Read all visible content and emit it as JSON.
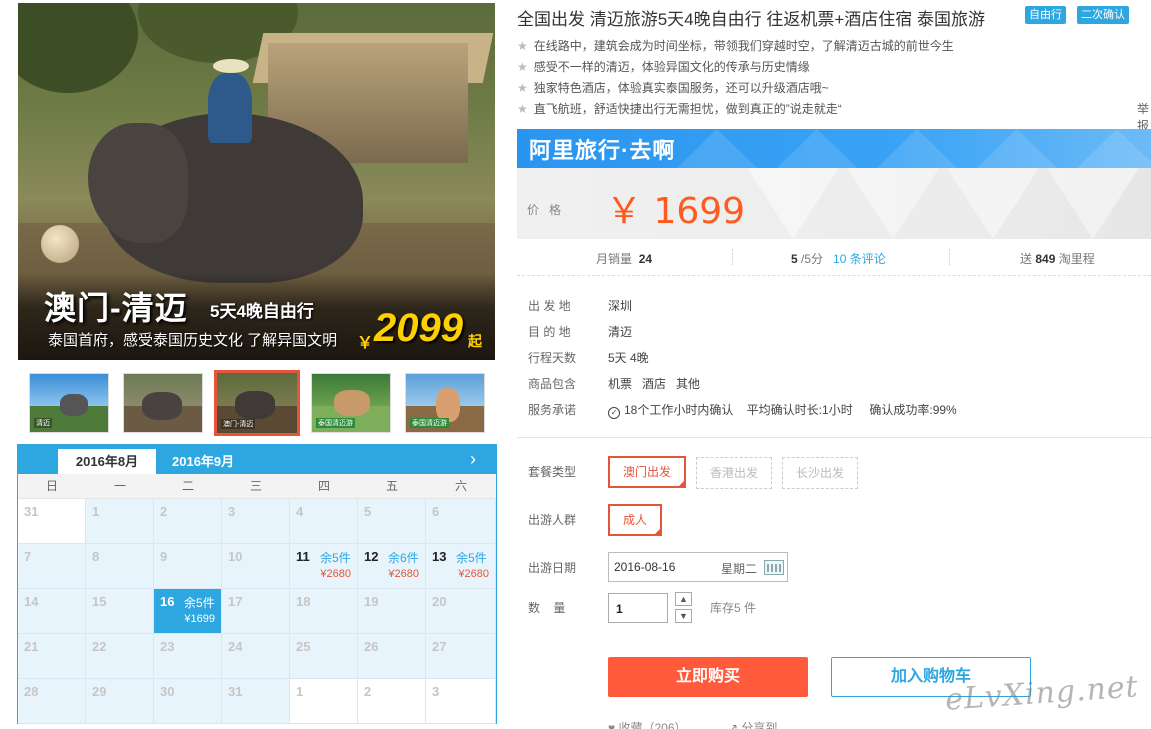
{
  "product": {
    "title": "全国出发 清迈旅游5天4晚自由行 往返机票+酒店住宿 泰国旅游",
    "badges": [
      "自由行",
      "二次确认"
    ],
    "features": [
      "在线路中，建筑会成为时间坐标，带领我们穿越时空，了解清迈古城的前世今生",
      "感受不一样的清迈，体验异国文化的传承与历史情缘",
      "独家特色酒店，体验真实泰国服务，还可以升级酒店哦~",
      "直飞航班，舒适快捷出行无需担忧，做到真正的”说走就走“"
    ],
    "report_link": "举报"
  },
  "main_image": {
    "title": "澳门-清迈",
    "subtitle": "5天4晚自由行",
    "desc": "泰国首府，感受泰国历史文化 了解异国文明",
    "currency": "￥",
    "price": "2099",
    "suffix": "起"
  },
  "thumbnails": [
    {
      "tag": "清迈",
      "active": false
    },
    {
      "tag": "",
      "active": false
    },
    {
      "tag": "澳门-清迈",
      "active": true
    },
    {
      "tag": "泰国清迈游",
      "active": false
    },
    {
      "tag": "泰国清迈游",
      "active": false
    }
  ],
  "calendar": {
    "tabs": [
      "2016年8月",
      "2016年9月"
    ],
    "next_icon": "chevron-right-icon",
    "weekdays": [
      "日",
      "一",
      "二",
      "三",
      "四",
      "五",
      "六"
    ],
    "weeks": [
      [
        {
          "d": "31",
          "t": "white"
        },
        {
          "d": "1"
        },
        {
          "d": "2"
        },
        {
          "d": "3"
        },
        {
          "d": "4"
        },
        {
          "d": "5"
        },
        {
          "d": "6"
        }
      ],
      [
        {
          "d": "7"
        },
        {
          "d": "8"
        },
        {
          "d": "9"
        },
        {
          "d": "10"
        },
        {
          "d": "11",
          "left": "余5件",
          "price": "¥2680",
          "t": "avail"
        },
        {
          "d": "12",
          "left": "余6件",
          "price": "¥2680",
          "t": "avail"
        },
        {
          "d": "13",
          "left": "余5件",
          "price": "¥2680",
          "t": "avail"
        }
      ],
      [
        {
          "d": "14"
        },
        {
          "d": "15"
        },
        {
          "d": "16",
          "left": "余5件",
          "price": "¥1699",
          "t": "sel"
        },
        {
          "d": "17"
        },
        {
          "d": "18"
        },
        {
          "d": "19"
        },
        {
          "d": "20"
        }
      ],
      [
        {
          "d": "21"
        },
        {
          "d": "22"
        },
        {
          "d": "23"
        },
        {
          "d": "24"
        },
        {
          "d": "25"
        },
        {
          "d": "26"
        },
        {
          "d": "27"
        }
      ],
      [
        {
          "d": "28"
        },
        {
          "d": "29"
        },
        {
          "d": "30"
        },
        {
          "d": "31"
        },
        {
          "d": "1",
          "t": "white"
        },
        {
          "d": "2",
          "t": "white"
        },
        {
          "d": "3",
          "t": "white"
        }
      ]
    ]
  },
  "brand": "阿里旅行·去啊",
  "price": {
    "label": "价格",
    "value": "￥ 1699"
  },
  "stats": {
    "monthly_sales_label": "月销量",
    "monthly_sales": "24",
    "rating": "5",
    "rating_suffix": " /5分",
    "reviews": "10 条评论",
    "send_label": "送",
    "miles": "849",
    "miles_suffix": " 淘里程"
  },
  "details": [
    {
      "label": "出 发 地",
      "value": "深圳"
    },
    {
      "label": "目 的 地",
      "value": "清迈"
    },
    {
      "label": "行程天数",
      "value": "5天 4晚"
    },
    {
      "label": "商品包含",
      "value": "机票   酒店   其他"
    },
    {
      "label": "服务承诺",
      "value": "18个工作小时内确认    平均确认时长:1小时     确认成功率:99%"
    }
  ],
  "options": {
    "package_label": "套餐类型",
    "packages": [
      "澳门出发",
      "香港出发",
      "长沙出发"
    ],
    "people_label": "出游人群",
    "people": [
      "成人"
    ],
    "date_label": "出游日期",
    "date_value": "2016-08-16",
    "date_week": "星期二",
    "qty_label": "数    量",
    "qty_value": "1",
    "stock": "库存5 件"
  },
  "actions": {
    "buy": "立即购买",
    "cart": "加入购物车",
    "fav": "收藏（206）",
    "share": "分享到"
  },
  "watermark": "eLvXing.net",
  "colors": {
    "accent": "#2ea7e0",
    "price": "#ff5a1f",
    "buy": "#ff5a3c",
    "selected": "#e4553a"
  }
}
